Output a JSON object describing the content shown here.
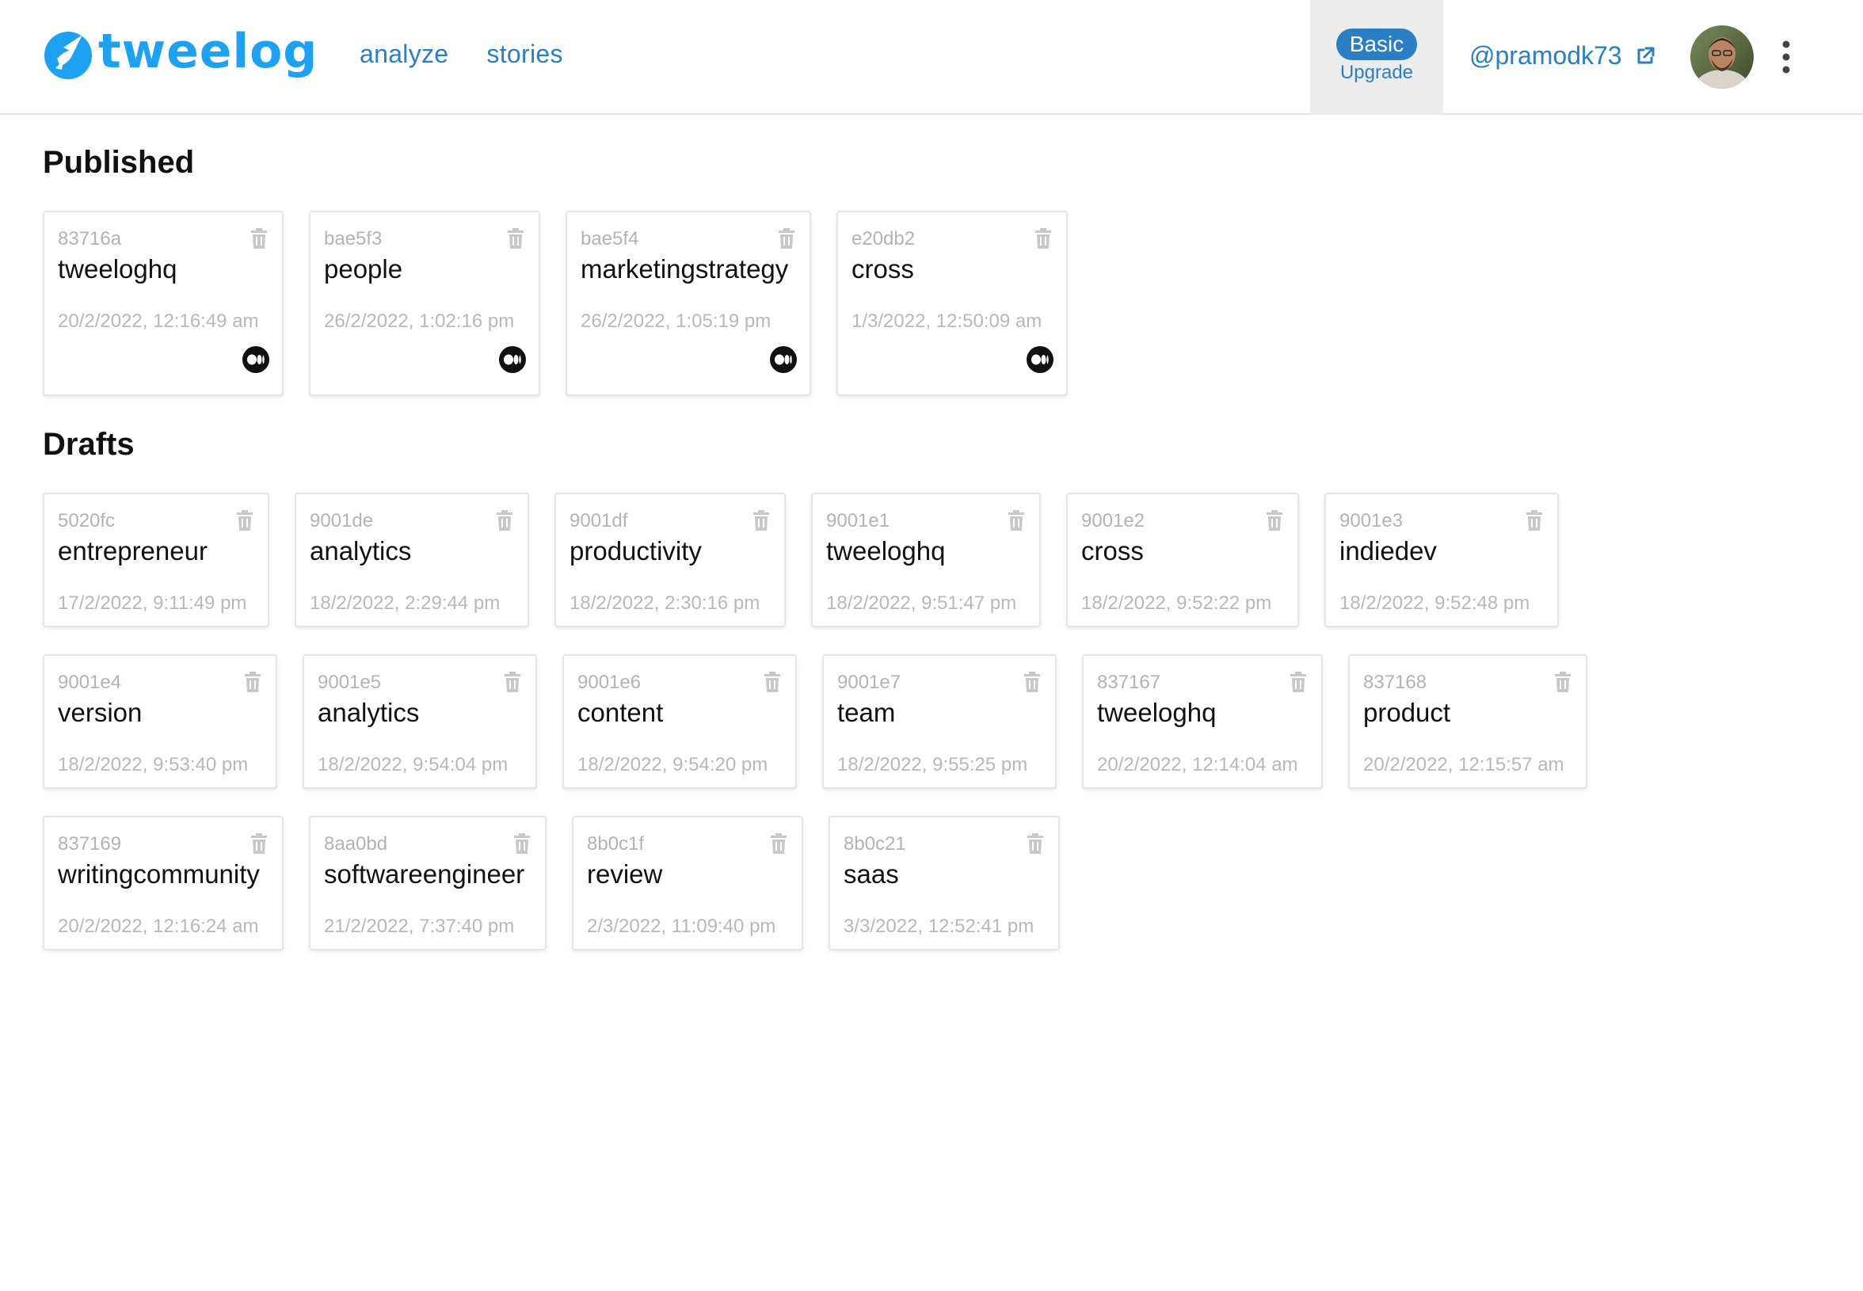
{
  "header": {
    "logo_text": "tweelog",
    "nav": [
      {
        "label": "analyze"
      },
      {
        "label": "stories"
      }
    ],
    "plan": {
      "badge": "Basic",
      "upgrade": "Upgrade"
    },
    "handle": "@pramodk73",
    "colors": {
      "brand": "#1da1f2",
      "link": "#2a7fc4"
    }
  },
  "published": {
    "title": "Published",
    "cards": [
      {
        "id": "83716a",
        "tag": "tweeloghq",
        "date": "20/2/2022, 12:16:49 am"
      },
      {
        "id": "bae5f3",
        "tag": "people",
        "date": "26/2/2022, 1:02:16 pm"
      },
      {
        "id": "bae5f4",
        "tag": "marketingstrategy",
        "date": "26/2/2022, 1:05:19 pm"
      },
      {
        "id": "e20db2",
        "tag": "cross",
        "date": "1/3/2022, 12:50:09 am"
      }
    ]
  },
  "drafts": {
    "title": "Drafts",
    "cards": [
      {
        "id": "5020fc",
        "tag": "entrepreneur",
        "date": "17/2/2022, 9:11:49 pm"
      },
      {
        "id": "9001de",
        "tag": "analytics",
        "date": "18/2/2022, 2:29:44 pm"
      },
      {
        "id": "9001df",
        "tag": "productivity",
        "date": "18/2/2022, 2:30:16 pm"
      },
      {
        "id": "9001e1",
        "tag": "tweeloghq",
        "date": "18/2/2022, 9:51:47 pm"
      },
      {
        "id": "9001e2",
        "tag": "cross",
        "date": "18/2/2022, 9:52:22 pm"
      },
      {
        "id": "9001e3",
        "tag": "indiedev",
        "date": "18/2/2022, 9:52:48 pm"
      },
      {
        "id": "9001e4",
        "tag": "version",
        "date": "18/2/2022, 9:53:40 pm"
      },
      {
        "id": "9001e5",
        "tag": "analytics",
        "date": "18/2/2022, 9:54:04 pm"
      },
      {
        "id": "9001e6",
        "tag": "content",
        "date": "18/2/2022, 9:54:20 pm"
      },
      {
        "id": "9001e7",
        "tag": "team",
        "date": "18/2/2022, 9:55:25 pm"
      },
      {
        "id": "837167",
        "tag": "tweeloghq",
        "date": "20/2/2022, 12:14:04 am"
      },
      {
        "id": "837168",
        "tag": "product",
        "date": "20/2/2022, 12:15:57 am"
      },
      {
        "id": "837169",
        "tag": "writingcommunity",
        "date": "20/2/2022, 12:16:24 am"
      },
      {
        "id": "8aa0bd",
        "tag": "softwareengineer",
        "date": "21/2/2022, 7:37:40 pm"
      },
      {
        "id": "8b0c1f",
        "tag": "review",
        "date": "2/3/2022, 11:09:40 pm"
      },
      {
        "id": "8b0c21",
        "tag": "saas",
        "date": "3/3/2022, 12:52:41 pm"
      }
    ]
  },
  "icons": [
    "logo-icon",
    "external-link-icon",
    "avatar",
    "more-vertical-icon",
    "trash-icon",
    "medium-icon"
  ]
}
